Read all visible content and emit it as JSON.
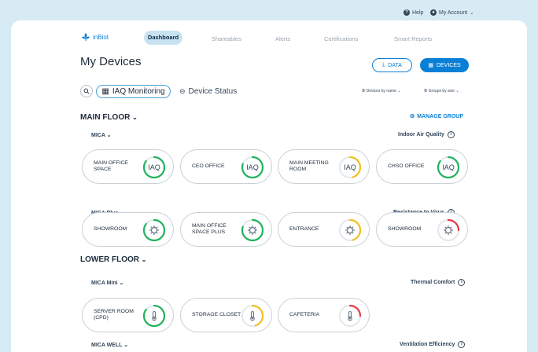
{
  "topbar": {
    "help": "Help",
    "account": "My Account"
  },
  "nav": {
    "logo": "inBiot",
    "tabs": [
      "Dashboard",
      "Shareables",
      "Alerts",
      "Certifications",
      "Smart Reports"
    ]
  },
  "page": {
    "title": "My Devices",
    "data_button": "DATA",
    "devices_button": "DEVICES"
  },
  "filters": {
    "iaq_tab": "IAQ Monitoring",
    "status_tab": "Device Status",
    "sort_name": "Devices by name",
    "sort_size": "Groups by size"
  },
  "groups": {
    "main_floor": {
      "title": "MAIN FLOOR",
      "manage": "MANAGE GROUP",
      "sections": [
        {
          "name": "MICA",
          "indicator": "Indoor Air Quality",
          "devices": [
            {
              "name": "MAIN OFFICE SPACE",
              "gauge": "IAQ",
              "level": 0.85,
              "color": "#21b35e"
            },
            {
              "name": "CEO OFFICE",
              "gauge": "IAQ",
              "level": 0.8,
              "color": "#21b35e"
            },
            {
              "name": "MAIN MEETING ROOM",
              "gauge": "IAQ",
              "level": 0.45,
              "color": "#f0c020"
            },
            {
              "name": "CHSO OFFICE",
              "gauge": "IAQ",
              "level": 0.85,
              "color": "#21b35e"
            }
          ]
        },
        {
          "name": "MICA Plus",
          "indicator": "Resistance to Virus",
          "devices": [
            {
              "name": "SHOWROOM",
              "gauge": "virus-icon",
              "level": 0.85,
              "color": "#21b35e"
            },
            {
              "name": "MAIN OFFICE SPACE PLUS",
              "gauge": "virus-icon",
              "level": 0.8,
              "color": "#21b35e"
            },
            {
              "name": "ENTRANCE",
              "gauge": "virus-icon",
              "level": 0.45,
              "color": "#f0c020"
            },
            {
              "name": "SHOWROOM",
              "gauge": "virus-icon",
              "level": 0.25,
              "color": "#e8394a"
            }
          ]
        }
      ]
    },
    "lower_floor": {
      "title": "LOWER FLOOR",
      "sections": [
        {
          "name": "MICA Mini",
          "indicator": "Thermal Comfort",
          "devices": [
            {
              "name": "SERVER ROOM (CPD)",
              "gauge": "thermometer-icon",
              "level": 0.85,
              "color": "#21b35e"
            },
            {
              "name": "STORAGE CLOSET",
              "gauge": "thermometer-icon",
              "level": 0.45,
              "color": "#f0c020"
            },
            {
              "name": "CAFETERIA",
              "gauge": "thermometer-icon",
              "level": 0.25,
              "color": "#e8394a"
            }
          ]
        },
        {
          "name": "MICA WELL",
          "indicator": "Ventilation Efficiency"
        }
      ]
    }
  }
}
